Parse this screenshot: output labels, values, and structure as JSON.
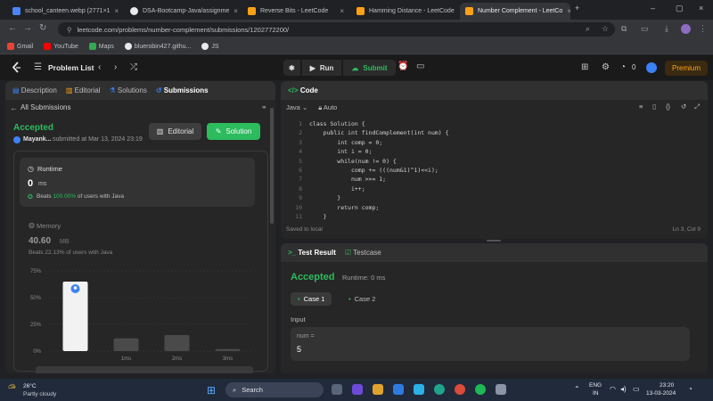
{
  "browser": {
    "tabs": [
      {
        "title": "school_canteen.webp (2771×1",
        "favicon": "#4a86f7"
      },
      {
        "title": "DSA-Bootcamp-Java/assignme",
        "favicon": "#e8eaed"
      },
      {
        "title": "Reverse Bits - LeetCode",
        "favicon": "#ffa116"
      },
      {
        "title": "Hamming Distance - LeetCode",
        "favicon": "#ffa116"
      },
      {
        "title": "Number Complement - LeetCo",
        "favicon": "#ffa116"
      }
    ],
    "url": "leetcode.com/problems/number-complement/submissions/1202772200/",
    "bookmarks": [
      "Gmail",
      "YouTube",
      "Maps",
      "bluerobin427.githu...",
      "JS"
    ]
  },
  "header": {
    "problem_list": "Problem List",
    "run": "Run",
    "submit": "Submit",
    "streak": "0",
    "premium": "Premium"
  },
  "left_panel": {
    "tabs": [
      "Description",
      "Editorial",
      "Solutions",
      "Submissions"
    ],
    "all_submissions": "All Submissions",
    "status": "Accepted",
    "user": "Mayank...",
    "submitted_at": "submitted at Mar 13, 2024 23:19",
    "editorial_btn": "Editorial",
    "solution_btn": "Solution",
    "runtime_label": "Runtime",
    "runtime_value": "0",
    "runtime_unit": "ms",
    "runtime_beats_pre": "Beats",
    "runtime_beats_pct": "100.00%",
    "runtime_beats_post": "of users with Java",
    "memory_label": "Memory",
    "memory_value": "40.60",
    "memory_unit": "MB",
    "memory_beats": "Beats 22.13% of users with Java"
  },
  "chart_data": {
    "type": "bar",
    "y_ticks": [
      "75%",
      "50%",
      "25%",
      "0%"
    ],
    "ylim": [
      0,
      75
    ],
    "x_ticks": [
      "1ms",
      "2ms",
      "3ms"
    ],
    "bars": [
      {
        "x": "0ms",
        "value": 65,
        "highlight": true
      },
      {
        "x": "1ms",
        "value": 12
      },
      {
        "x": "2ms",
        "value": 15
      },
      {
        "x": "3ms",
        "value": 2
      }
    ]
  },
  "code_panel": {
    "title": "Code",
    "language": "Java",
    "mode": "Auto",
    "lines": [
      "class Solution {",
      "    public int findComplement(int num) {",
      "        int comp = 0;",
      "        int i = 0;",
      "        while(num != 0) {",
      "            comp += (((num&1)^1)<<i);",
      "            num >>= 1;",
      "            i++;",
      "        }",
      "        return comp;",
      "    }"
    ],
    "saved": "Saved to local",
    "cursor": "Ln 3, Col 9"
  },
  "test_panel": {
    "tab_result": "Test Result",
    "tab_case": "Testcase",
    "status": "Accepted",
    "runtime": "Runtime: 0 ms",
    "case1": "Case 1",
    "case2": "Case 2",
    "input_label": "Input",
    "var_name": "num =",
    "var_value": "5"
  },
  "taskbar": {
    "temp": "26°C",
    "weather": "Partly cloudy",
    "search": "Search",
    "lang1": "ENG",
    "lang2": "IN",
    "time": "23:20",
    "date": "13-03-2024"
  }
}
